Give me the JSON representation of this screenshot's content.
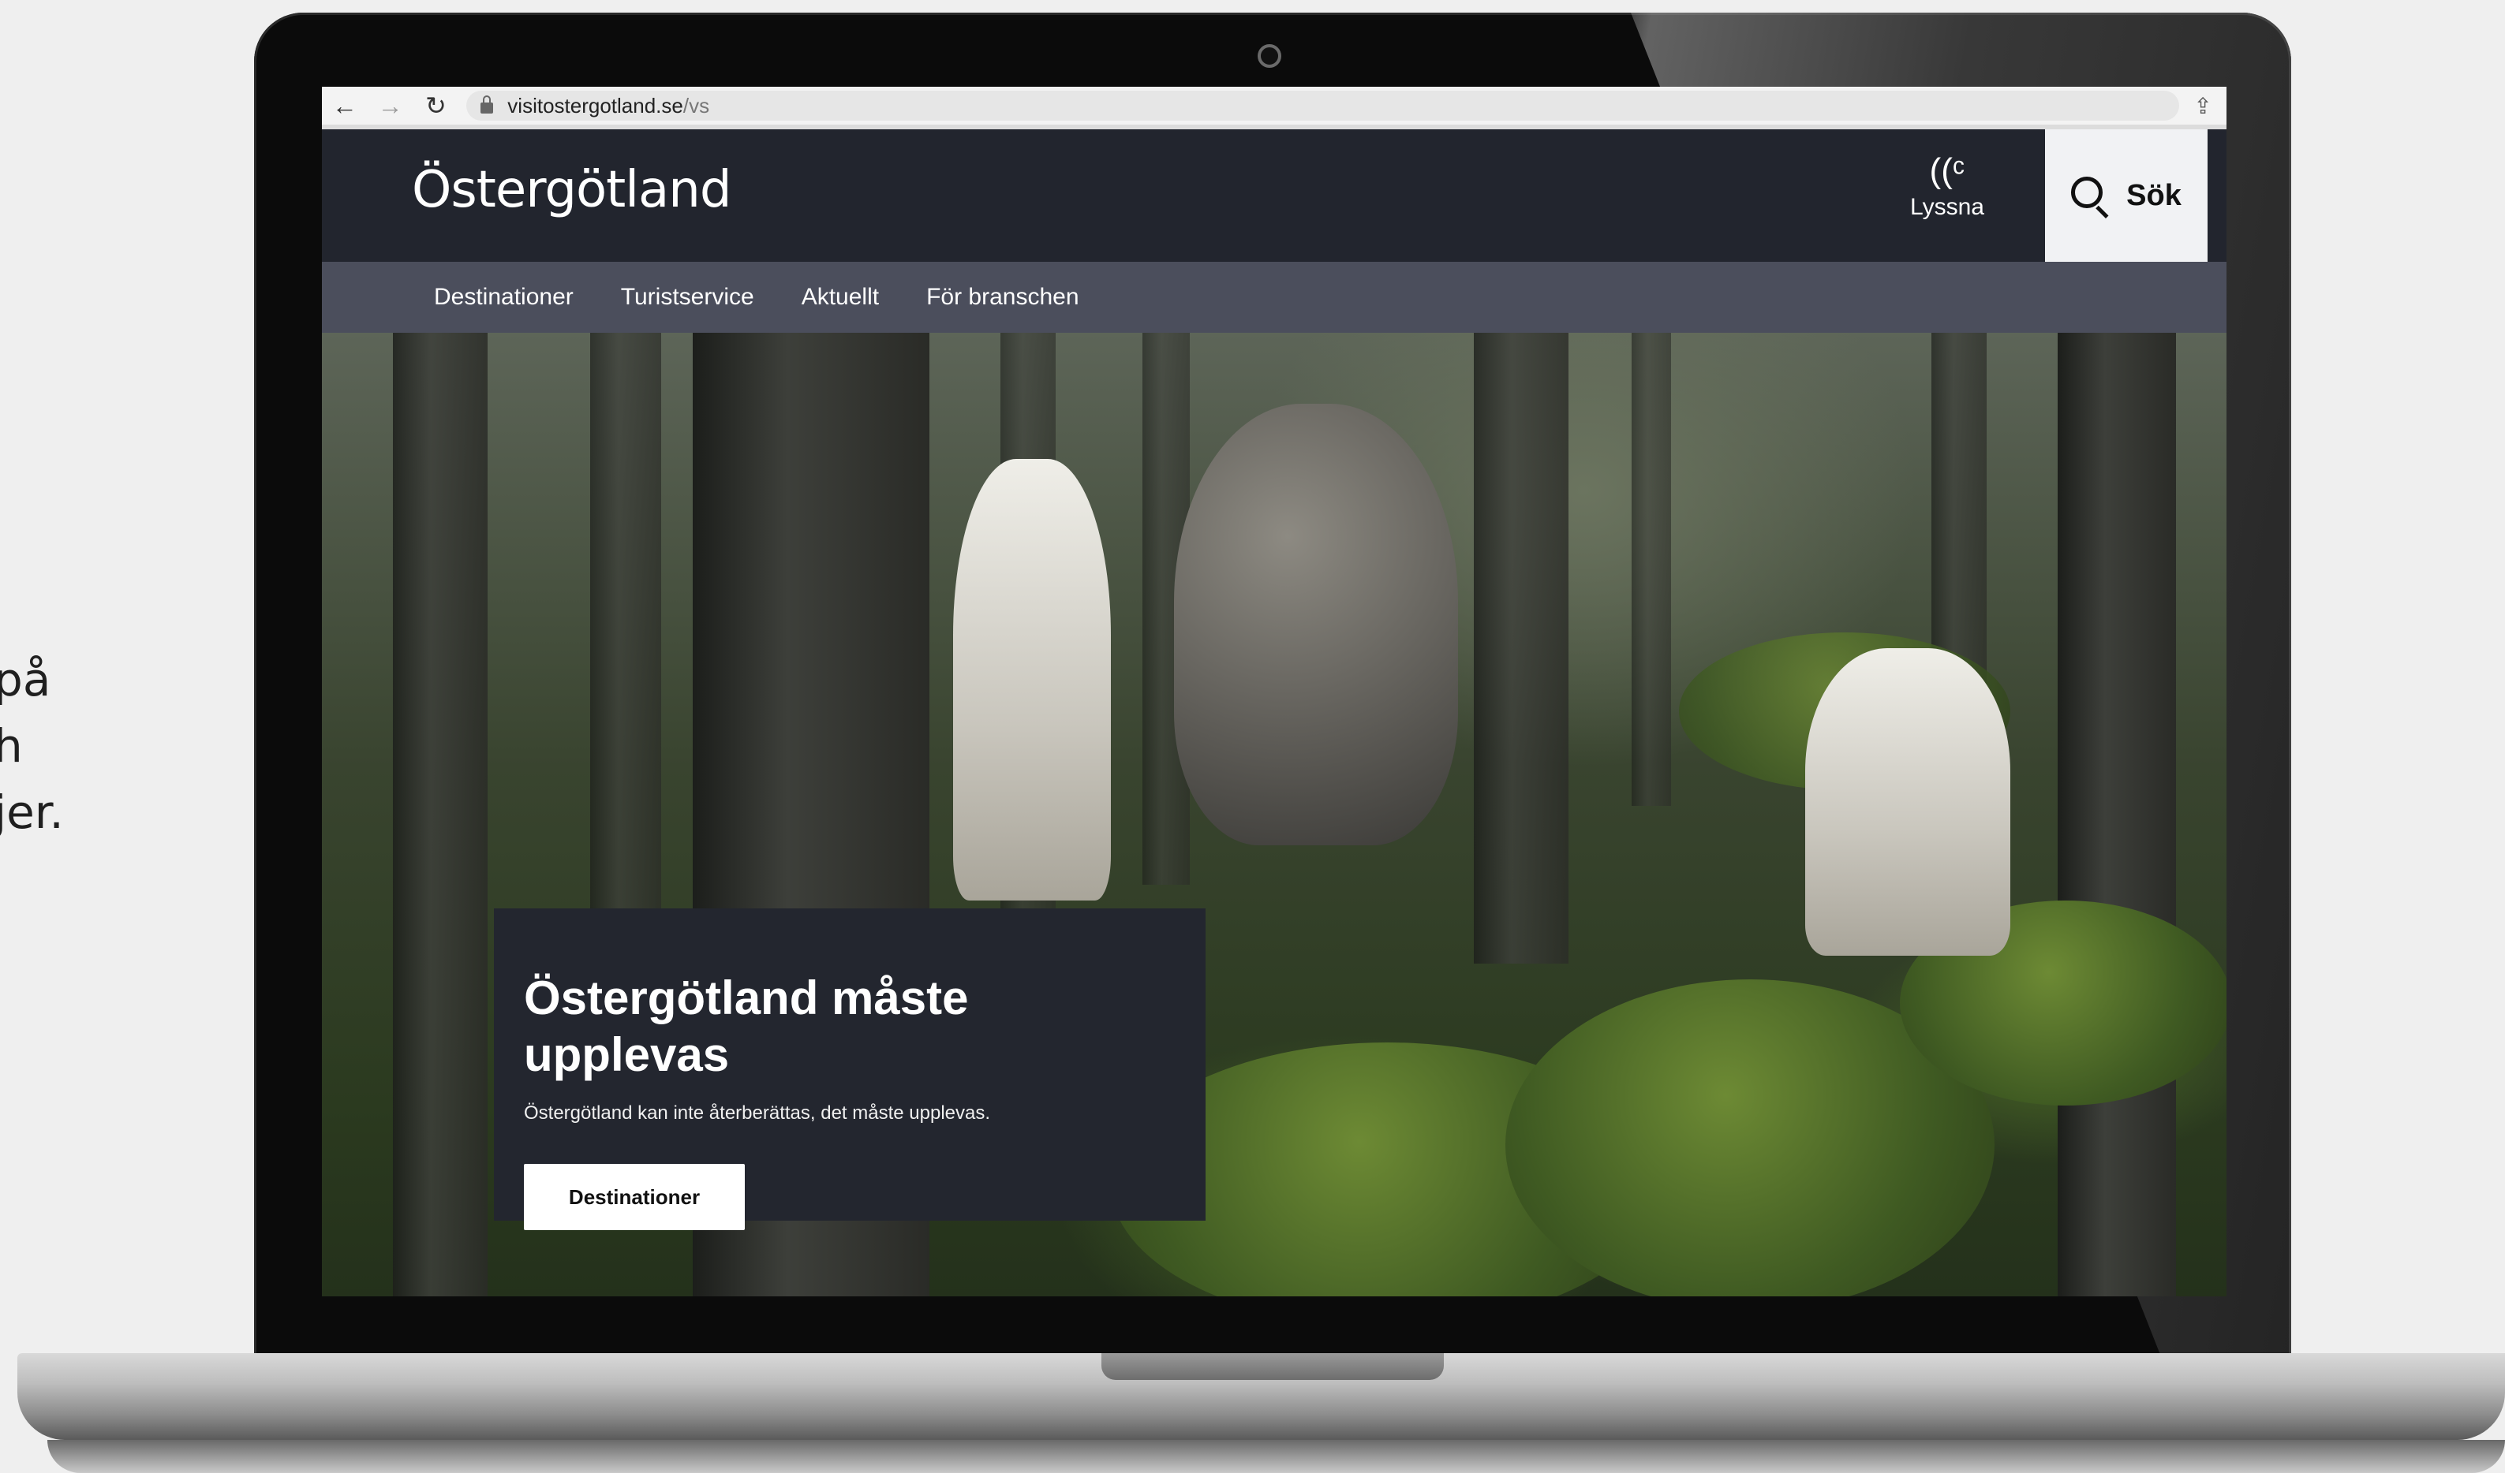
{
  "side_caption": {
    "lines": [
      "på",
      "h",
      "jer."
    ]
  },
  "browser": {
    "url_host": "visitostergotland.se",
    "url_path": "/vs",
    "icons": {
      "back": "arrow-left-icon",
      "forward": "arrow-right-icon",
      "reload": "reload-icon",
      "lock": "lock-icon",
      "share": "share-icon"
    }
  },
  "header": {
    "logo": "Östergötland",
    "listen_label": "Lyssna",
    "search_label": "Sök"
  },
  "nav": {
    "items": [
      {
        "label": "Destinationer"
      },
      {
        "label": "Turistservice"
      },
      {
        "label": "Aktuellt"
      },
      {
        "label": "För branschen"
      }
    ]
  },
  "hero": {
    "title": "Östergötland måste upplevas",
    "subtitle": "Östergötland kan inte återberättas, det måste upplevas.",
    "button_label": "Destinationer"
  },
  "colors": {
    "header_bg": "#22252e",
    "nav_bg": "#4b4e5c",
    "search_bg": "#f1f2f4",
    "card_bg": "#23262f"
  }
}
